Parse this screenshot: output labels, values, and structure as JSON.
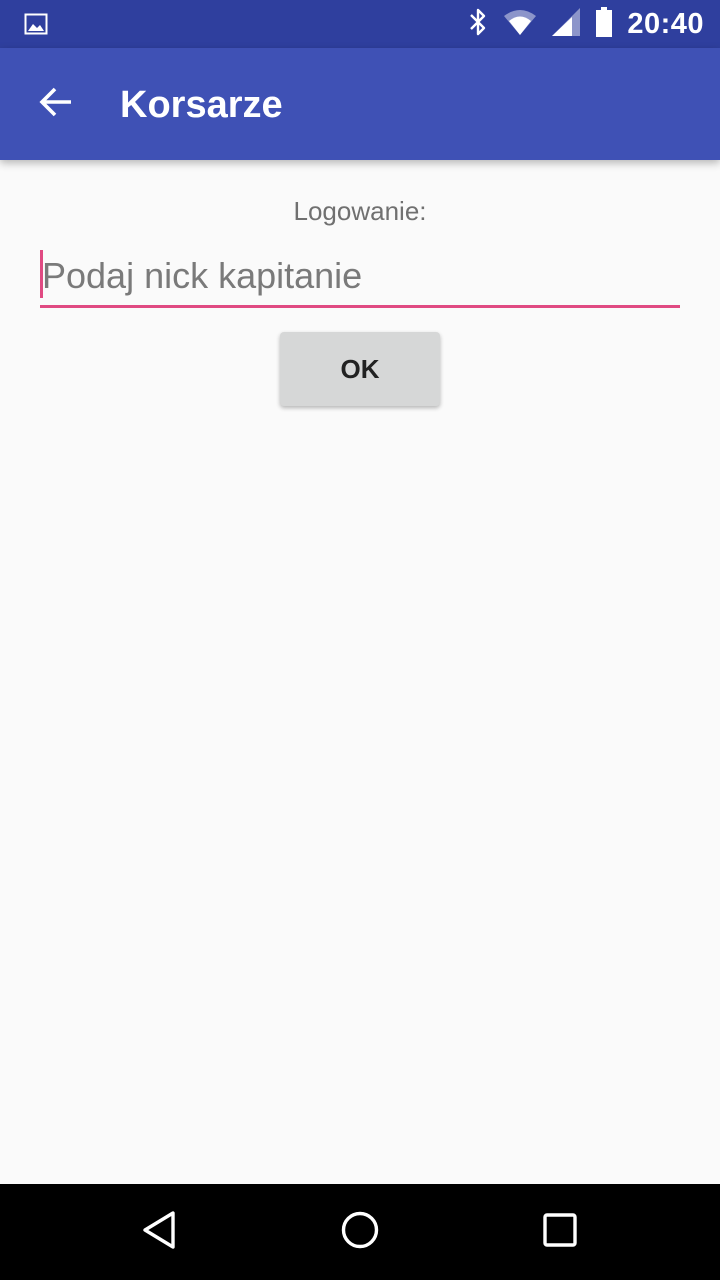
{
  "status_bar": {
    "time": "20:40",
    "icons": [
      "image-icon",
      "bluetooth-icon",
      "wifi-icon",
      "signal-icon",
      "battery-icon"
    ]
  },
  "app_bar": {
    "title": "Korsarze",
    "back_icon": "arrow-left-icon",
    "color": "#3f51b5"
  },
  "login": {
    "label": "Logowanie:",
    "nick_value": "",
    "nick_placeholder": "Podaj nick kapitanie",
    "accent_color": "#e04a82",
    "ok_label": "OK"
  },
  "nav_bar": {
    "icons": [
      "back-triangle-icon",
      "home-circle-icon",
      "recents-square-icon"
    ]
  }
}
